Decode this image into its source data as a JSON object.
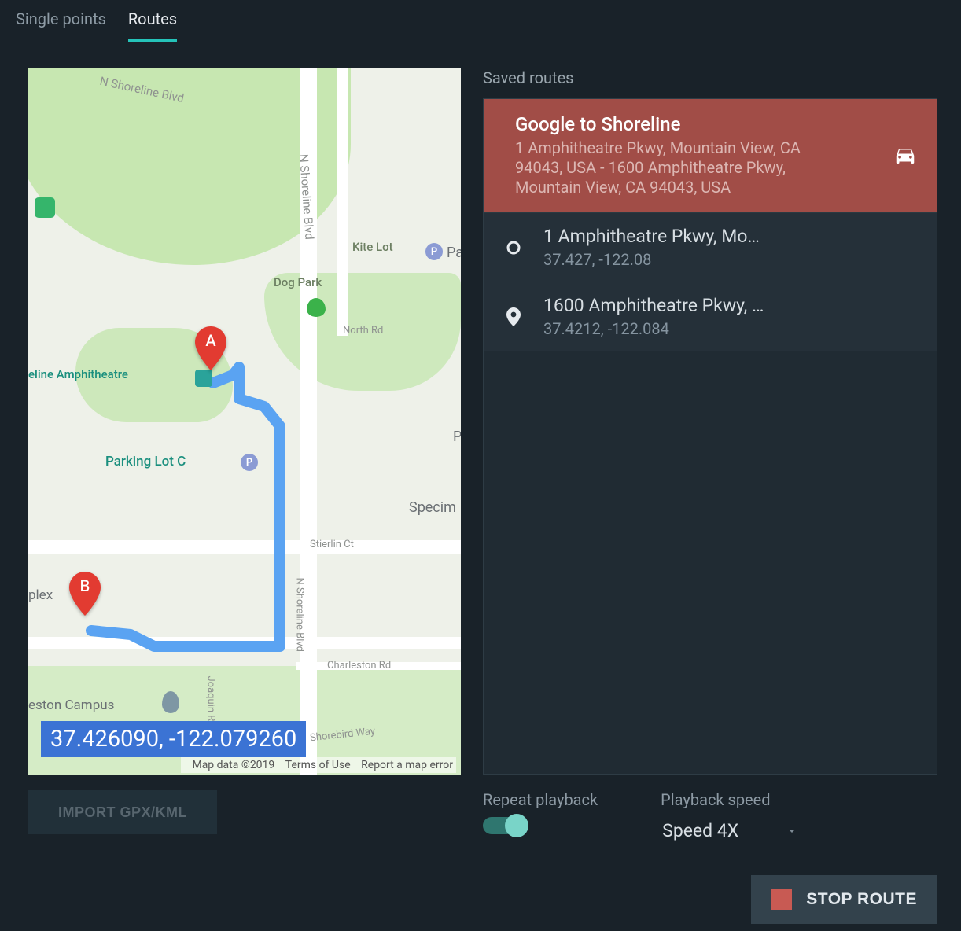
{
  "tabs": {
    "single": "Single points",
    "routes": "Routes"
  },
  "map": {
    "labels": {
      "shoreline_blvd_top": "N Shoreline Blvd",
      "shoreline_blvd_v": "N Shoreline Blvd",
      "kite_lot": "Kite Lot",
      "dog_park": "Dog Park",
      "amphitheatre": "eline Amphitheatre",
      "north_rd": "North Rd",
      "parking_c": "Parking Lot C",
      "specim": "Specim",
      "stierlin": "Stierlin Ct",
      "joaquin": "Joaquin R",
      "shorebird": "Shorebird Way",
      "charleston": "Charleston Rd",
      "eston": "eston Campus",
      "pa": "Pa",
      "plex": "plex",
      "p_right": "P"
    },
    "pins": {
      "a": "A",
      "b": "B"
    },
    "coord_badge": "37.426090, -122.079260",
    "footer": {
      "attr": "Map data ©2019",
      "terms": "Terms of Use",
      "report": "Report a map error"
    }
  },
  "import_button": "IMPORT GPX/KML",
  "saved": {
    "title": "Saved routes",
    "route": {
      "name": "Google to Shoreline",
      "desc": "1 Amphitheatre Pkwy, Mountain View, CA 94043, USA - 1600 Amphitheatre Pkwy, Mountain View, CA 94043, USA"
    },
    "waypoints": [
      {
        "addr": "1 Amphitheatre Pkwy, Mo…",
        "coords": "37.427, -122.08"
      },
      {
        "addr": "1600 Amphitheatre Pkwy, …",
        "coords": "37.4212, -122.084"
      }
    ]
  },
  "playback": {
    "repeat_label": "Repeat playback",
    "speed_label": "Playback speed",
    "speed_value": "Speed 4X"
  },
  "stop_button": "STOP ROUTE"
}
